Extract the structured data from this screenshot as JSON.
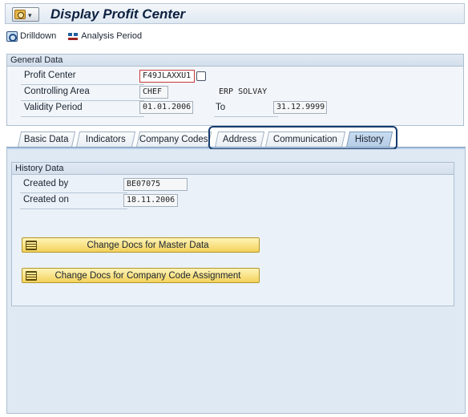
{
  "title": "Display Profit Center",
  "toolbar": {
    "drilldown": "Drilldown",
    "analysis_period": "Analysis Period"
  },
  "general": {
    "heading": "General Data",
    "profit_center_label": "Profit Center",
    "profit_center_value": "F49JLAXXU1",
    "controlling_area_label": "Controlling Area",
    "controlling_area_value": "CHEF",
    "controlling_area_desc": "ERP SOLVAY",
    "validity_label": "Validity Period",
    "valid_from": "01.01.2006",
    "to_label": "To",
    "valid_to": "31.12.9999"
  },
  "tabs": [
    "Basic Data",
    "Indicators",
    "Company Codes",
    "Address",
    "Communication",
    "History"
  ],
  "active_tab": "History",
  "history": {
    "heading": "History Data",
    "created_by_label": "Created by",
    "created_by_value": "BE07075",
    "created_on_label": "Created on",
    "created_on_value": "18.11.2006",
    "btn_master_data": "Change Docs for Master Data",
    "btn_company_code": "Change Docs for Company Code Assignment"
  },
  "colors": {
    "title": "#0d2140",
    "active_tab": "#b5cce6",
    "highlight_border": "#173c6e",
    "button": "#f3d25b"
  }
}
